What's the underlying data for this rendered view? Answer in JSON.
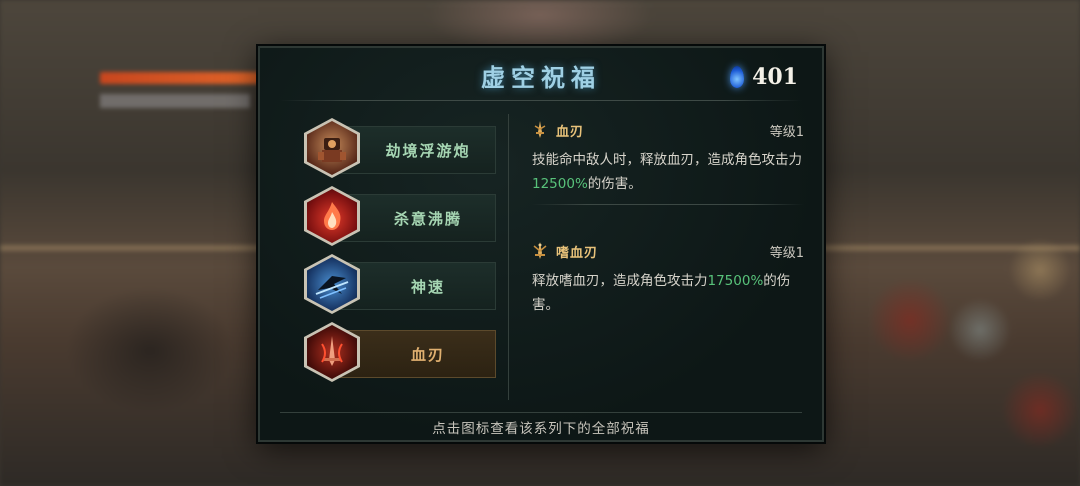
{
  "panel": {
    "title": "虚空祝福",
    "currency": {
      "icon": "blue-flame-gem-icon",
      "value": "401"
    },
    "footer_hint": "点击图标查看该系列下的全部祝福"
  },
  "series": [
    {
      "label": "劫境浮游炮",
      "icon": "mecha-warrior-icon",
      "selected": false
    },
    {
      "label": "杀意沸腾",
      "icon": "red-flame-icon",
      "selected": false
    },
    {
      "label": "神速",
      "icon": "speed-rider-icon",
      "selected": false
    },
    {
      "label": "血刃",
      "icon": "blood-blade-icon",
      "selected": true
    }
  ],
  "blessings": [
    {
      "icon": "blood-blade-small-icon",
      "name": "血刃",
      "level": "等级1",
      "desc_before": "技能命中敌人时，释放血刃，造成角色攻击力",
      "desc_value": "12500%",
      "desc_after": "的伤害。"
    },
    {
      "icon": "bloodthirst-blade-small-icon",
      "name": "嗜血刃",
      "level": "等级1",
      "desc_before": "释放嗜血刃，造成角色攻击力",
      "desc_value": "17500%",
      "desc_after": "的伤害。"
    }
  ],
  "colors": {
    "title": "#9fd0e4",
    "highlight": "#58c27a",
    "selected_tab_text": "#e0b070",
    "tab_text": "#a6d6b3"
  }
}
